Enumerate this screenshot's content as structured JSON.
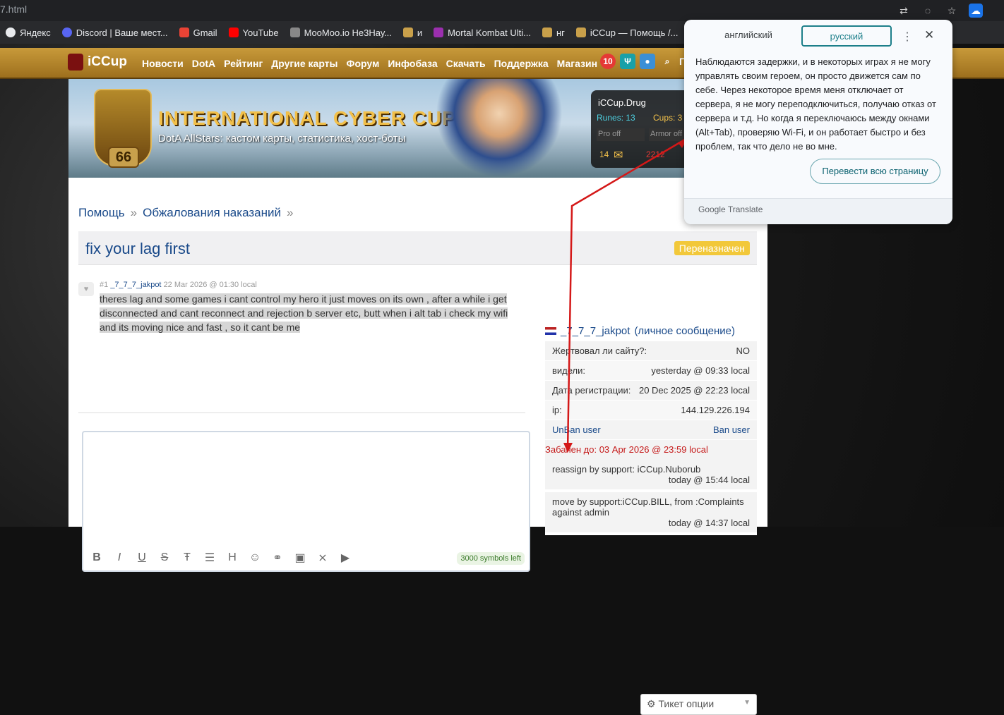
{
  "browser": {
    "url_fragment": "7.html",
    "bookmarks": [
      {
        "label": "Яндекс",
        "color": "#e8eaed"
      },
      {
        "label": "Discord | Ваше мест...",
        "color": "#5865f2"
      },
      {
        "label": "Gmail",
        "color": "#ea4335"
      },
      {
        "label": "YouTube",
        "color": "#ff0000"
      },
      {
        "label": "MooMoo.io Не3Нау...",
        "color": "#888888"
      },
      {
        "label": "и",
        "color": "#c9a04a"
      },
      {
        "label": "Mortal Kombat Ulti...",
        "color": "#9b2fae"
      },
      {
        "label": "нг",
        "color": "#c9a04a"
      },
      {
        "label": "iCCup — Помощь /...",
        "color": "#c9a04a"
      }
    ]
  },
  "site": {
    "logo": "iCCup",
    "nav": [
      "Новости",
      "DotA",
      "Рейтинг",
      "Другие карты",
      "Форум",
      "Инфобаза",
      "Скачать",
      "Поддержка",
      "Магазин"
    ],
    "notif_count": "10",
    "search_label": "По",
    "banner": {
      "title": "INTERNATIONAL CYBER CUP",
      "subtitle": "DotA AllStars: кастом карты, статистика, хост-боты",
      "level": "66"
    },
    "profile": {
      "name": "iCCup.Drug",
      "runes_label": "Runes: 13",
      "cups_label": "Cups: 3",
      "pro": "Pro off",
      "armor": "Armor off",
      "messages": "14",
      "points": "2212"
    }
  },
  "breadcrumb": {
    "home": "Помощь",
    "sep": "»",
    "section": "Обжалования наказаний"
  },
  "ticket": {
    "title": "fix your lag first",
    "status": "Переназначен",
    "post": {
      "number": "#1",
      "author": "_7_7_7_jakpot",
      "date": "22 Mar 2026 @ 01:30 local",
      "text": "theres lag and some games i cant control my hero it just moves on its own , after a while i get disconnected and cant reconnect and rejection b server etc, butt when i alt tab i check my wifi and its moving nice and fast , so it cant be me"
    },
    "symbols_left": "3000 symbols left"
  },
  "sidebar": {
    "user": "_7_7_7_jakpot",
    "pm": "(личное сообщение)",
    "rows": [
      {
        "k": "Жертвовал ли сайту?:",
        "v": "NO"
      },
      {
        "k": "видели:",
        "v": "yesterday @ 09:33 local"
      },
      {
        "k": "Дата регистрации:",
        "v": "20 Dec 2025 @ 22:23 local"
      },
      {
        "k": "ip:",
        "v": "144.129.226.194"
      }
    ],
    "unban": "UnBan user",
    "ban": "Ban user",
    "banned_until": "Забанен до: 03 Apr 2026 @ 23:59 local",
    "log": [
      {
        "text": "reassign by support: iCCup.Nuborub",
        "time": "today @ 15:44 local"
      },
      {
        "text": "move by support:iCCup.BILL, from :Complaints against admin",
        "time": "today @ 14:37 local"
      }
    ],
    "ticket_options": "Тикет опции"
  },
  "translate_popup": {
    "tab_en": "английский",
    "tab_ru": "русский",
    "translation": "Наблюдаются задержки, и в некоторых играх я не могу управлять своим героем, он просто движется сам по себе. Через некоторое время меня отключает от сервера, я не могу переподключиться, получаю отказ от сервера и т.д. Но когда я переключаюсь между окнами (Alt+Tab), проверяю Wi-Fi, и он работает быстро и без проблем, так что дело не во мне.",
    "translate_page": "Перевести всю страницу",
    "footer": "Google Translate"
  }
}
